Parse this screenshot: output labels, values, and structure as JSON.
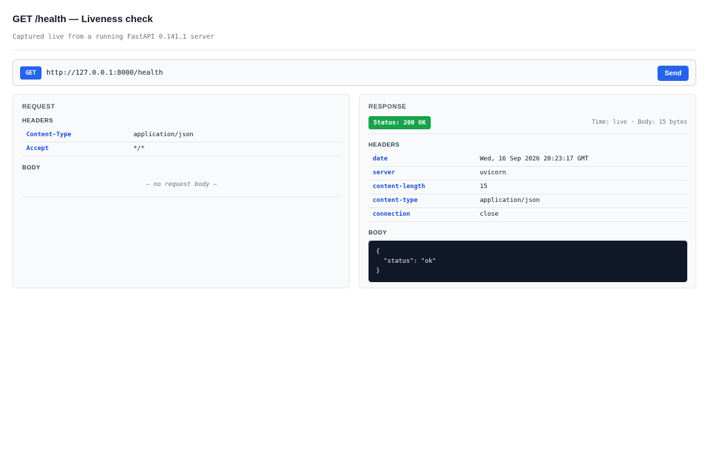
{
  "header": {
    "title": "GET /health — Liveness check",
    "subtitle": "Captured live from a running FastAPI 0.141.1 server"
  },
  "url_bar": {
    "method": "GET",
    "url": "http://127.0.0.1:8000/health",
    "send_label": "Send"
  },
  "request": {
    "title": "REQUEST",
    "headers_title": "HEADERS",
    "headers": [
      {
        "key": "Content-Type",
        "value": "application/json"
      },
      {
        "key": "Accept",
        "value": "*/*"
      }
    ],
    "body_title": "BODY",
    "body_empty": "— no request body —"
  },
  "response": {
    "title": "RESPONSE",
    "status": "Status: 200 OK",
    "meta": "Time: live · Body: 15 bytes",
    "headers_title": "HEADERS",
    "headers": [
      {
        "key": "date",
        "value": "Wed, 16 Sep 2026 20:23:17 GMT"
      },
      {
        "key": "server",
        "value": "uvicorn"
      },
      {
        "key": "content-length",
        "value": "15"
      },
      {
        "key": "content-type",
        "value": "application/json"
      },
      {
        "key": "connection",
        "value": "close"
      }
    ],
    "body_title": "BODY",
    "body_lines": [
      "{",
      "  \"status\": \"ok\"",
      "}"
    ]
  },
  "colors": {
    "accent": "#2563eb",
    "success": "#16a34a",
    "header_key": "#1d4ed8",
    "code_bg": "#111827"
  },
  "icons": []
}
